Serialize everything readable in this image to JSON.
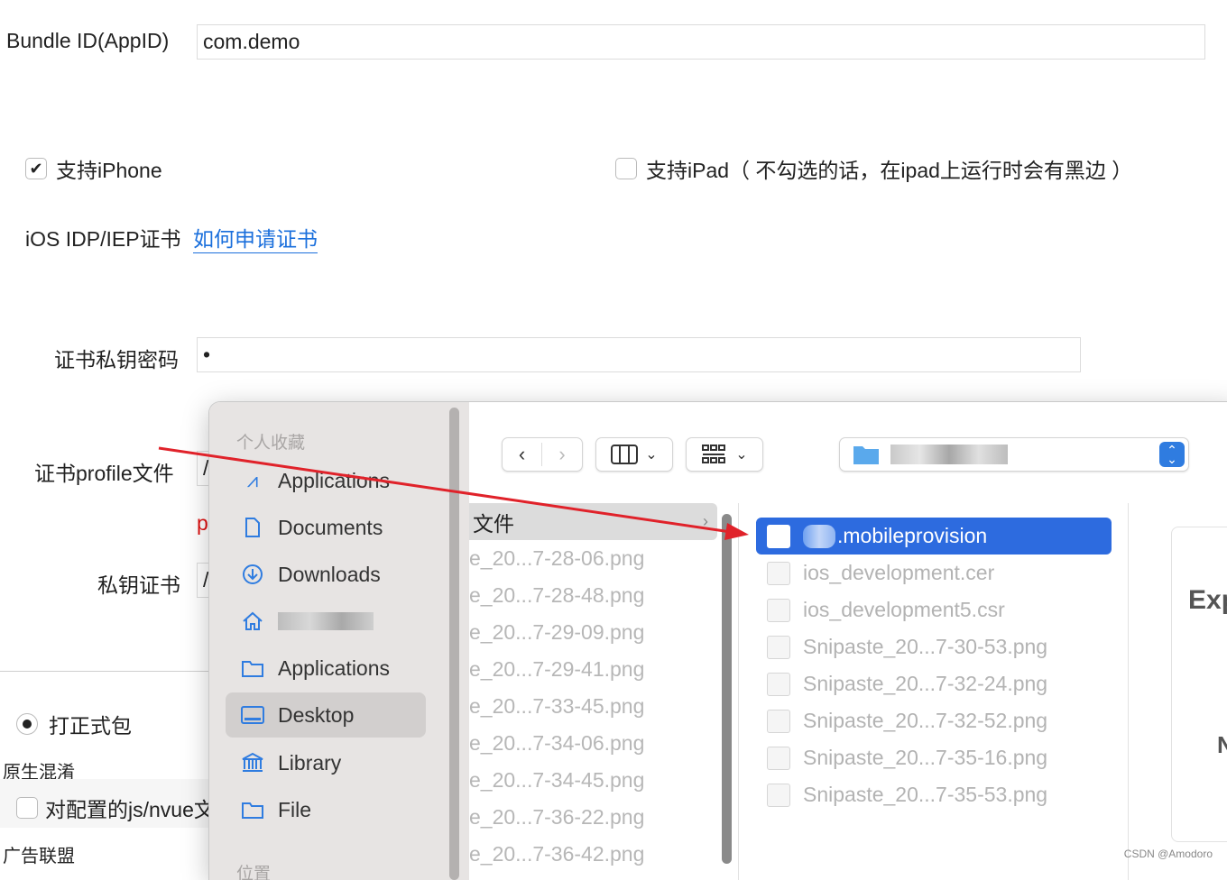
{
  "form": {
    "bundle_label": "Bundle ID(AppID)",
    "bundle_value": "com.demo",
    "iphone_label": "支持iPhone",
    "iphone_checked": true,
    "ipad_label": "支持iPad（ 不勾选的话，在ipad上运行时会有黑边 ）",
    "ipad_checked": false,
    "cert_label": "iOS IDP/IEP证书",
    "cert_link": "如何申请证书",
    "key_pwd_label": "证书私钥密码",
    "key_pwd_value": "•",
    "profile_label": "证书profile文件",
    "profile_value": "/",
    "red_hint": "p",
    "private_cert_label": "私钥证书",
    "private_cert_value": "/",
    "release_label": "打正式包",
    "native_label": "原生混淆",
    "obfuscate_label": "对配置的js/nvue文",
    "ad_label": "广告联盟"
  },
  "dialog": {
    "sidebar": {
      "section_favorites": "个人收藏",
      "section_locations": "位置",
      "items": [
        {
          "label": "Applications",
          "icon": "app-store-icon"
        },
        {
          "label": "Documents",
          "icon": "document-icon"
        },
        {
          "label": "Downloads",
          "icon": "download-icon"
        },
        {
          "label": "",
          "icon": "home-icon"
        },
        {
          "label": "Applications",
          "icon": "folder-icon"
        },
        {
          "label": "Desktop",
          "icon": "desktop-icon",
          "selected": true
        },
        {
          "label": "Library",
          "icon": "library-icon"
        },
        {
          "label": "File",
          "icon": "folder-icon"
        }
      ]
    },
    "column1": {
      "selected": "文件",
      "files": [
        "e_20...7-28-06.png",
        "e_20...7-28-48.png",
        "e_20...7-29-09.png",
        "e_20...7-29-41.png",
        "e_20...7-33-45.png",
        "e_20...7-34-06.png",
        "e_20...7-34-45.png",
        "e_20...7-36-22.png",
        "e_20...7-36-42.png"
      ]
    },
    "column2": {
      "selected": ".mobileprovision",
      "files": [
        "ios_development.cer",
        "ios_development5.csr",
        "Snipaste_20...7-30-53.png",
        "Snipaste_20...7-32-24.png",
        "Snipaste_20...7-32-52.png",
        "Snipaste_20...7-35-16.png",
        "Snipaste_20...7-35-53.png"
      ]
    },
    "preview": {
      "title": "Exp",
      "letter": "N"
    },
    "accent": "#2d6bdf"
  },
  "watermark": "CSDN @Amodoro",
  "arrow_color": "#e0222a"
}
